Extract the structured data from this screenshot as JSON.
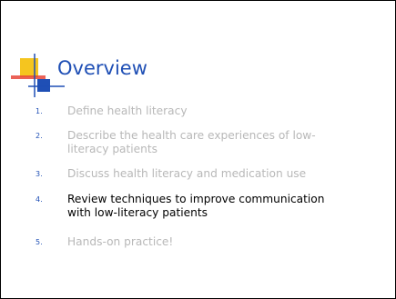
{
  "slide": {
    "title": "Overview",
    "items": [
      {
        "number": "1.",
        "text": "Define health literacy",
        "active": false
      },
      {
        "number": "2.",
        "text": "Describe the health care experiences of low-literacy patients",
        "active": false
      },
      {
        "number": "3.",
        "text": "Discuss health literacy and medication use",
        "active": false
      },
      {
        "number": "4.",
        "text": "Review techniques to improve communication with low-literacy patients",
        "active": true
      },
      {
        "number": "5.",
        "text": "Hands-on practice!",
        "active": false
      }
    ]
  },
  "colors": {
    "title": "#1f4fb5",
    "number": "#1f4fb5",
    "inactive_text": "#b8b8b8",
    "active_text": "#000000",
    "accent_yellow": "#f5c51f",
    "accent_red": "#e8473b",
    "accent_blue": "#1f4fb5"
  }
}
